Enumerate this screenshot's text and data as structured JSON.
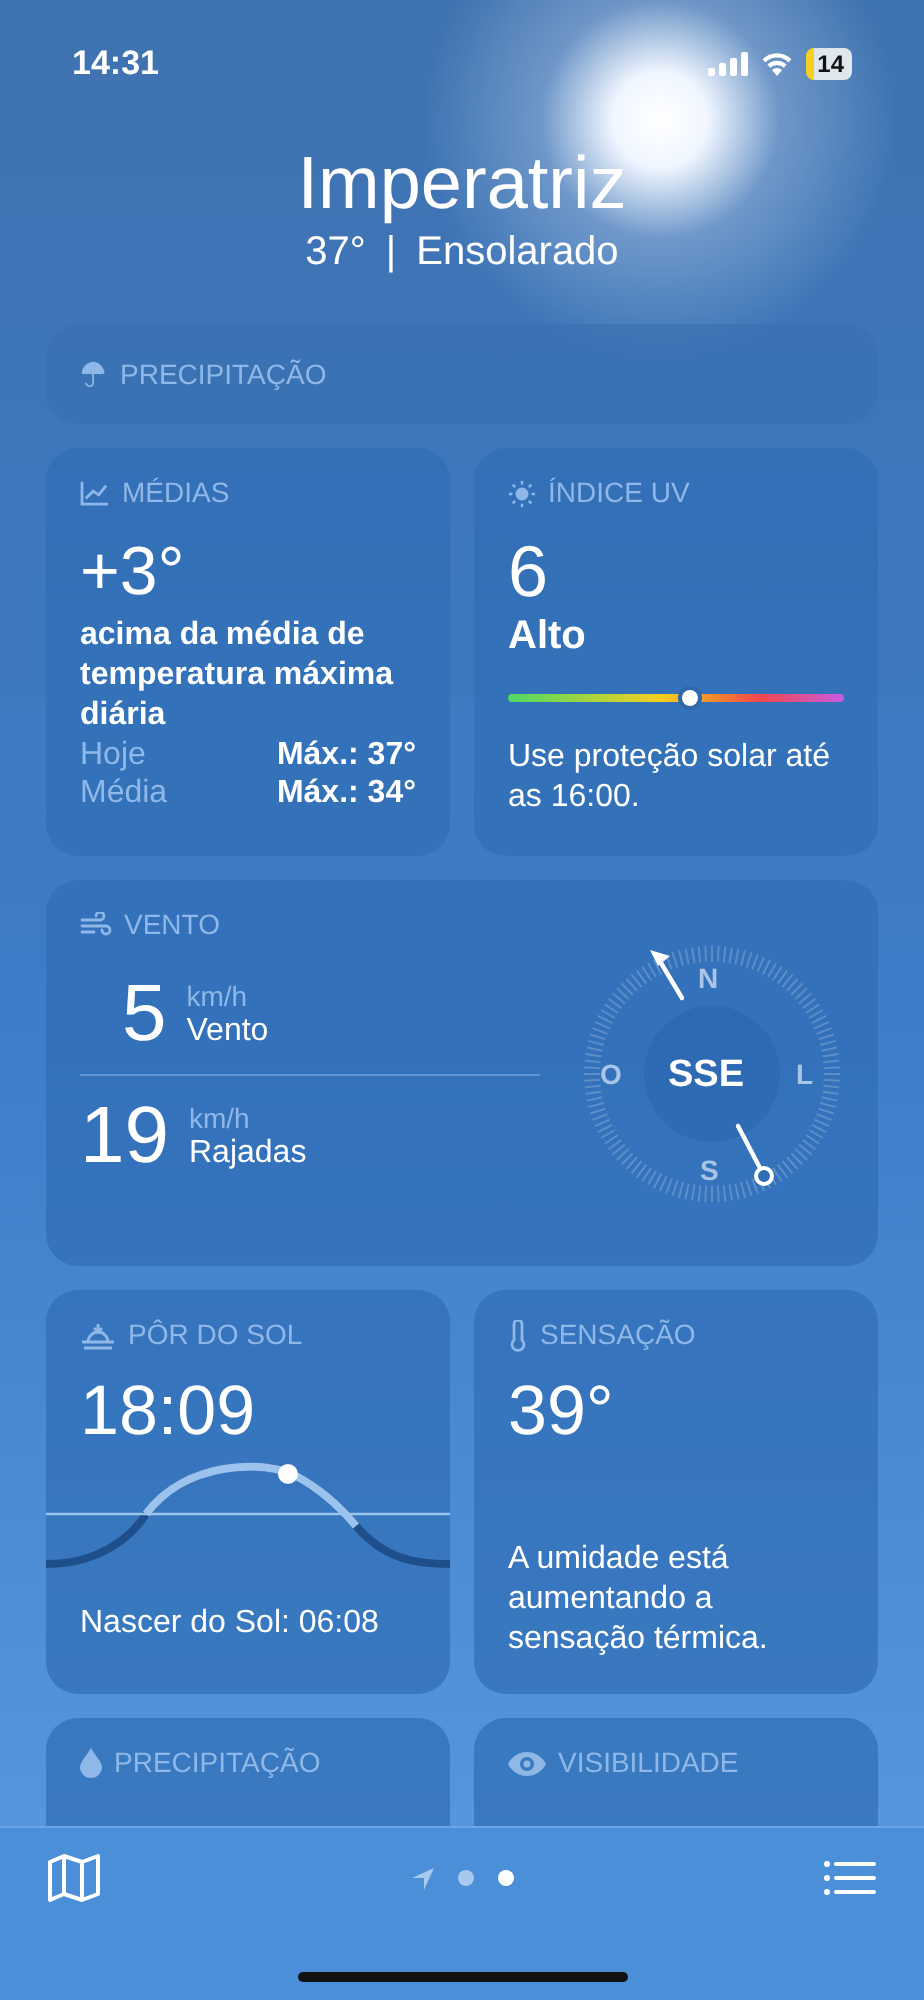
{
  "status_bar": {
    "time": "14:31",
    "battery": "14"
  },
  "header": {
    "city": "Imperatriz",
    "temperature": "37°",
    "separator": "|",
    "condition": "Ensolarado"
  },
  "precipitation_top": {
    "title": "PRECIPITAÇÃO"
  },
  "averages": {
    "title": "MÉDIAS",
    "value": "+3°",
    "description": "acima da média de temperatura máxima diária",
    "rows": [
      {
        "label": "Hoje",
        "value": "Máx.: 37°"
      },
      {
        "label": "Média",
        "value": "Máx.: 34°"
      }
    ]
  },
  "uv_index": {
    "title": "ÍNDICE UV",
    "value": "6",
    "level_text": "Alto",
    "level": 0.54,
    "note": "Use proteção solar até as 16:00."
  },
  "wind": {
    "title": "VENTO",
    "rows": [
      {
        "value": "5",
        "unit": "km/h",
        "label": "Vento"
      },
      {
        "value": "19",
        "unit": "km/h",
        "label": "Rajadas"
      }
    ],
    "direction": "SSE",
    "compass": {
      "north": "N",
      "east": "L",
      "south": "S",
      "west": "O"
    }
  },
  "sunset": {
    "title": "PÔR DO SOL",
    "time": "18:09",
    "sunrise": "Nascer do Sol: 06:08"
  },
  "feels_like": {
    "title": "SENSAÇÃO",
    "value": "39°",
    "note": "A umidade está aumentando a sensação térmica."
  },
  "bottom_cards": [
    {
      "kind": "drop",
      "title": "PRECIPITAÇÃO"
    },
    {
      "kind": "eye",
      "title": "VISIBILIDADE"
    }
  ],
  "page_indicator": [
    {
      "kind": "location",
      "selected": false
    },
    {
      "kind": "dot",
      "selected": false
    },
    {
      "kind": "dot",
      "selected": true
    }
  ]
}
